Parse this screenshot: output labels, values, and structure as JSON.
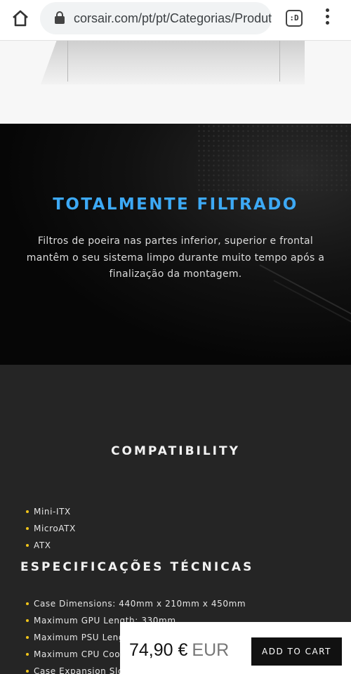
{
  "browser": {
    "url": "corsair.com/pt/pt/Categorias/Produto",
    "tab_switch_label": ":D"
  },
  "filter_section": {
    "title": "TOTALMENTE FILTRADO",
    "description": "Filtros de poeira nas partes inferior, superior e frontal mantêm o seu sistema limpo durante muito tempo após a finalização da montagem."
  },
  "compatibility": {
    "title": "COMPATIBILITY",
    "items": [
      "Mini-ITX",
      "MicroATX",
      "ATX"
    ]
  },
  "tech_specs": {
    "title": "ESPECIFICAÇÕES TÉCNICAS",
    "items": [
      "Case Dimensions: 440mm x 210mm x 450mm",
      "Maximum GPU Length: 330mm",
      "Maximum PSU Length",
      "Maximum CPU Cooler",
      "Case Expansion Slots"
    ]
  },
  "purchase_bar": {
    "price": "74,90 €",
    "currency": "EUR",
    "add_to_cart_label": "ADD TO CART"
  },
  "colors": {
    "accent_blue": "#3da9f5",
    "bullet_yellow": "#f0c419",
    "dark_bg": "#252525"
  }
}
